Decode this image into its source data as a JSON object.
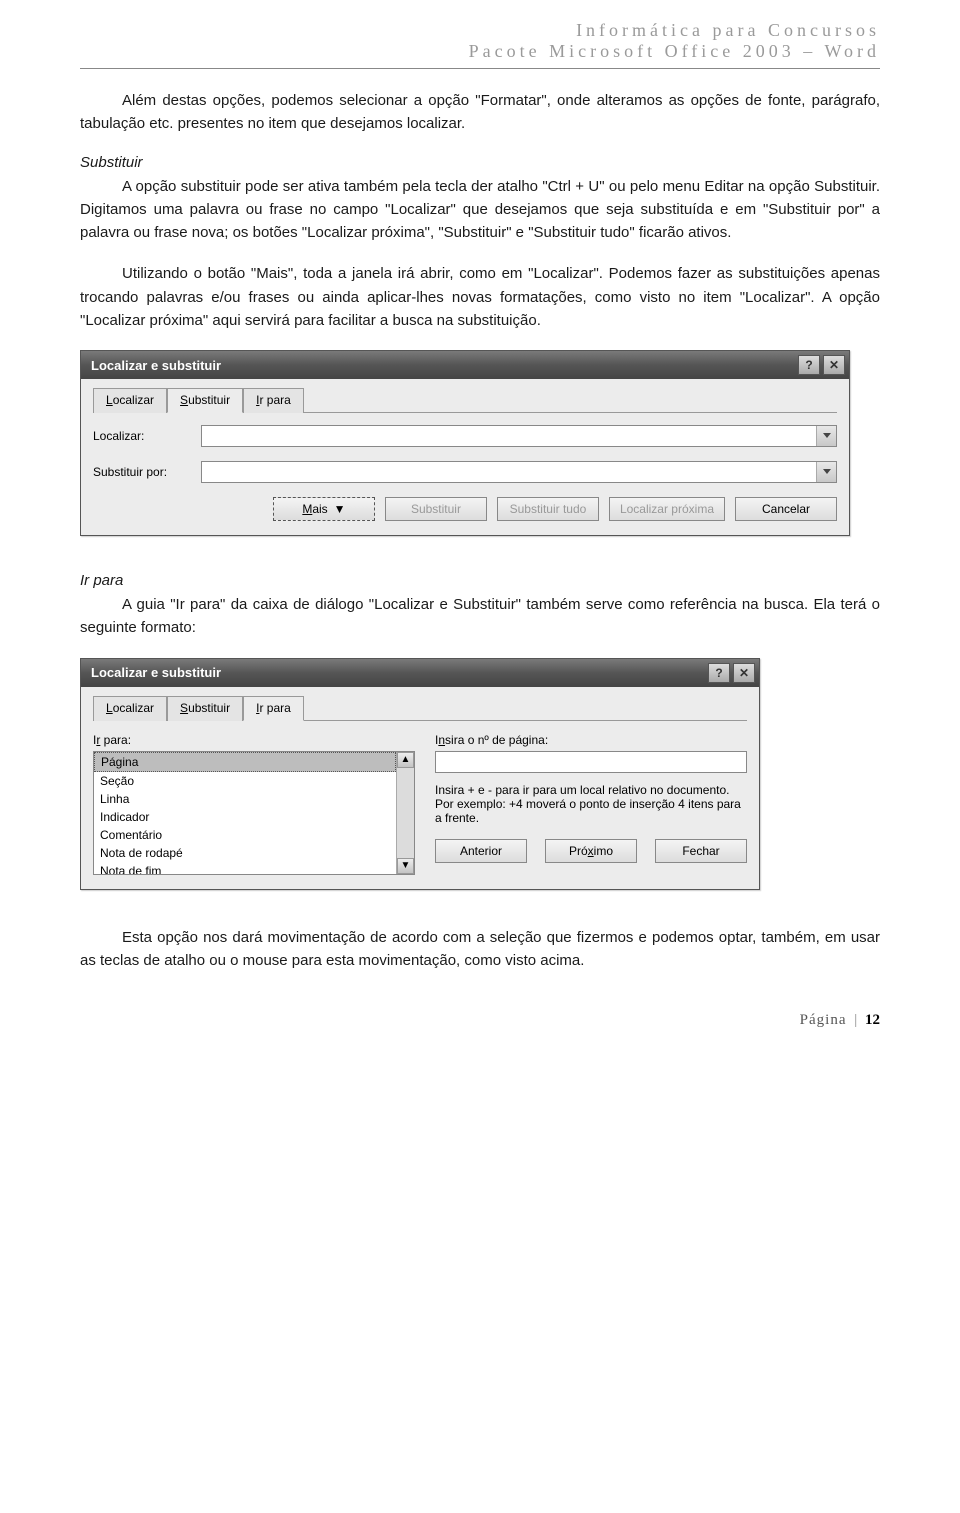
{
  "header": {
    "line1": "Informática para Concursos",
    "line2": "Pacote Microsoft Office 2003 – Word"
  },
  "para1": "Além destas opções, podemos selecionar a opção \"Formatar\", onde alteramos as opções de fonte, parágrafo, tabulação etc. presentes no item que desejamos localizar.",
  "sec_substituir_title": "Substituir",
  "para2": "A opção substituir pode ser ativa também pela tecla der atalho \"Ctrl + U\" ou pelo menu Editar na opção Substituir. Digitamos uma palavra ou frase no campo \"Localizar\" que desejamos que seja substituída e em \"Substituir por\" a palavra ou frase nova; os botões \"Localizar próxima\", \"Substituir\" e \"Substituir tudo\" ficarão ativos.",
  "para3": "Utilizando o botão \"Mais\", toda a janela irá abrir, como em \"Localizar\". Podemos fazer as substituições apenas trocando palavras e/ou frases ou ainda aplicar-lhes novas formatações, como visto no item \"Localizar\". A opção \"Localizar próxima\" aqui servirá para facilitar a busca na substituição.",
  "dialog1": {
    "title": "Localizar e substituir",
    "tabs": {
      "localizar": "Localizar",
      "substituir": "Substituir",
      "irpara": "Ir para"
    },
    "labels": {
      "localizar": "Localizar:",
      "substituir_por": "Substituir por:"
    },
    "buttons": {
      "mais": "Mais",
      "substituir": "Substituir",
      "substituir_tudo": "Substituir tudo",
      "localizar_prox": "Localizar próxima",
      "cancelar": "Cancelar"
    }
  },
  "sec_irpara_title": "Ir para",
  "para4": "A guia \"Ir para\" da caixa de diálogo \"Localizar e Substituir\" também serve como referência na busca. Ela terá o seguinte formato:",
  "dialog2": {
    "title": "Localizar e substituir",
    "tabs": {
      "localizar": "Localizar",
      "substituir": "Substituir",
      "irpara": "Ir para"
    },
    "left_label": "Ir para:",
    "items": [
      "Página",
      "Seção",
      "Linha",
      "Indicador",
      "Comentário",
      "Nota de rodapé",
      "Nota de fim"
    ],
    "right_label": "Insira o nº de página:",
    "hint": "Insira + e - para ir para um local relativo no documento. Por exemplo: +4 moverá o ponto de inserção 4 itens para a frente.",
    "buttons": {
      "anterior": "Anterior",
      "proximo": "Próximo",
      "fechar": "Fechar"
    }
  },
  "para5": "Esta opção nos dará movimentação de acordo com a seleção que fizermos e podemos optar, também, em usar as teclas de atalho ou o mouse para esta movimentação, como visto acima.",
  "footer": {
    "label": "Página",
    "number": "12"
  }
}
